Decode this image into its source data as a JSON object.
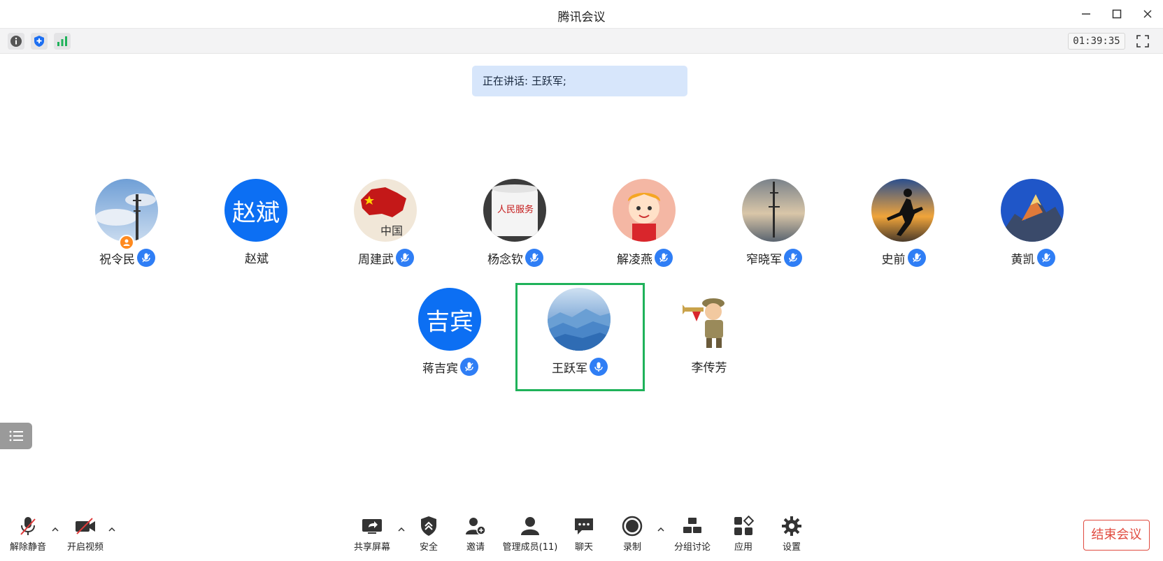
{
  "window": {
    "title": "腾讯会议"
  },
  "top_toolbar": {
    "timer": "01:39:35",
    "icons": [
      "info-icon",
      "shield-icon",
      "signal-icon",
      "fullscreen-icon"
    ]
  },
  "speaking": {
    "text": "正在讲话: 王跃军;"
  },
  "participants_row1": [
    {
      "name": "祝令民",
      "avatar_type": "photo-sky-tower",
      "mic": true,
      "host": true
    },
    {
      "name": "赵斌",
      "avatar_type": "text",
      "avatar_text": "赵斌",
      "mic": false
    },
    {
      "name": "周建武",
      "avatar_type": "photo-china-map",
      "mic": true
    },
    {
      "name": "杨念钦",
      "avatar_type": "photo-mug",
      "mic": true
    },
    {
      "name": "解凌燕",
      "avatar_type": "photo-cartoon-girl",
      "mic": true
    },
    {
      "name": "窄晓军",
      "avatar_type": "photo-sea-tower",
      "mic": true
    },
    {
      "name": "史前",
      "avatar_type": "photo-runner",
      "mic": true
    },
    {
      "name": "黄凯",
      "avatar_type": "photo-mountain",
      "mic": true
    }
  ],
  "participants_row2": [
    {
      "name": "蒋吉宾",
      "avatar_type": "text",
      "avatar_text": "吉宾",
      "mic": true
    },
    {
      "name": "王跃军",
      "avatar_type": "photo-blue-mountains",
      "mic": true,
      "speaking": true
    },
    {
      "name": "李传芳",
      "avatar_type": "photo-cartoon-soldier",
      "mic": false
    }
  ],
  "bottom_toolbar": {
    "unmute": "解除静音",
    "start_video": "开启视频",
    "share_screen": "共享屏幕",
    "security": "安全",
    "invite": "邀请",
    "manage_members": "管理成员(11)",
    "chat": "聊天",
    "record": "录制",
    "breakout": "分组讨论",
    "apps": "应用",
    "settings": "设置",
    "end_meeting": "结束会议"
  },
  "colors": {
    "accent_blue": "#0c6ff3",
    "speaking_frame": "#1fb25a",
    "end_button": "#e04a3f",
    "banner_bg": "#d7e6fb"
  }
}
